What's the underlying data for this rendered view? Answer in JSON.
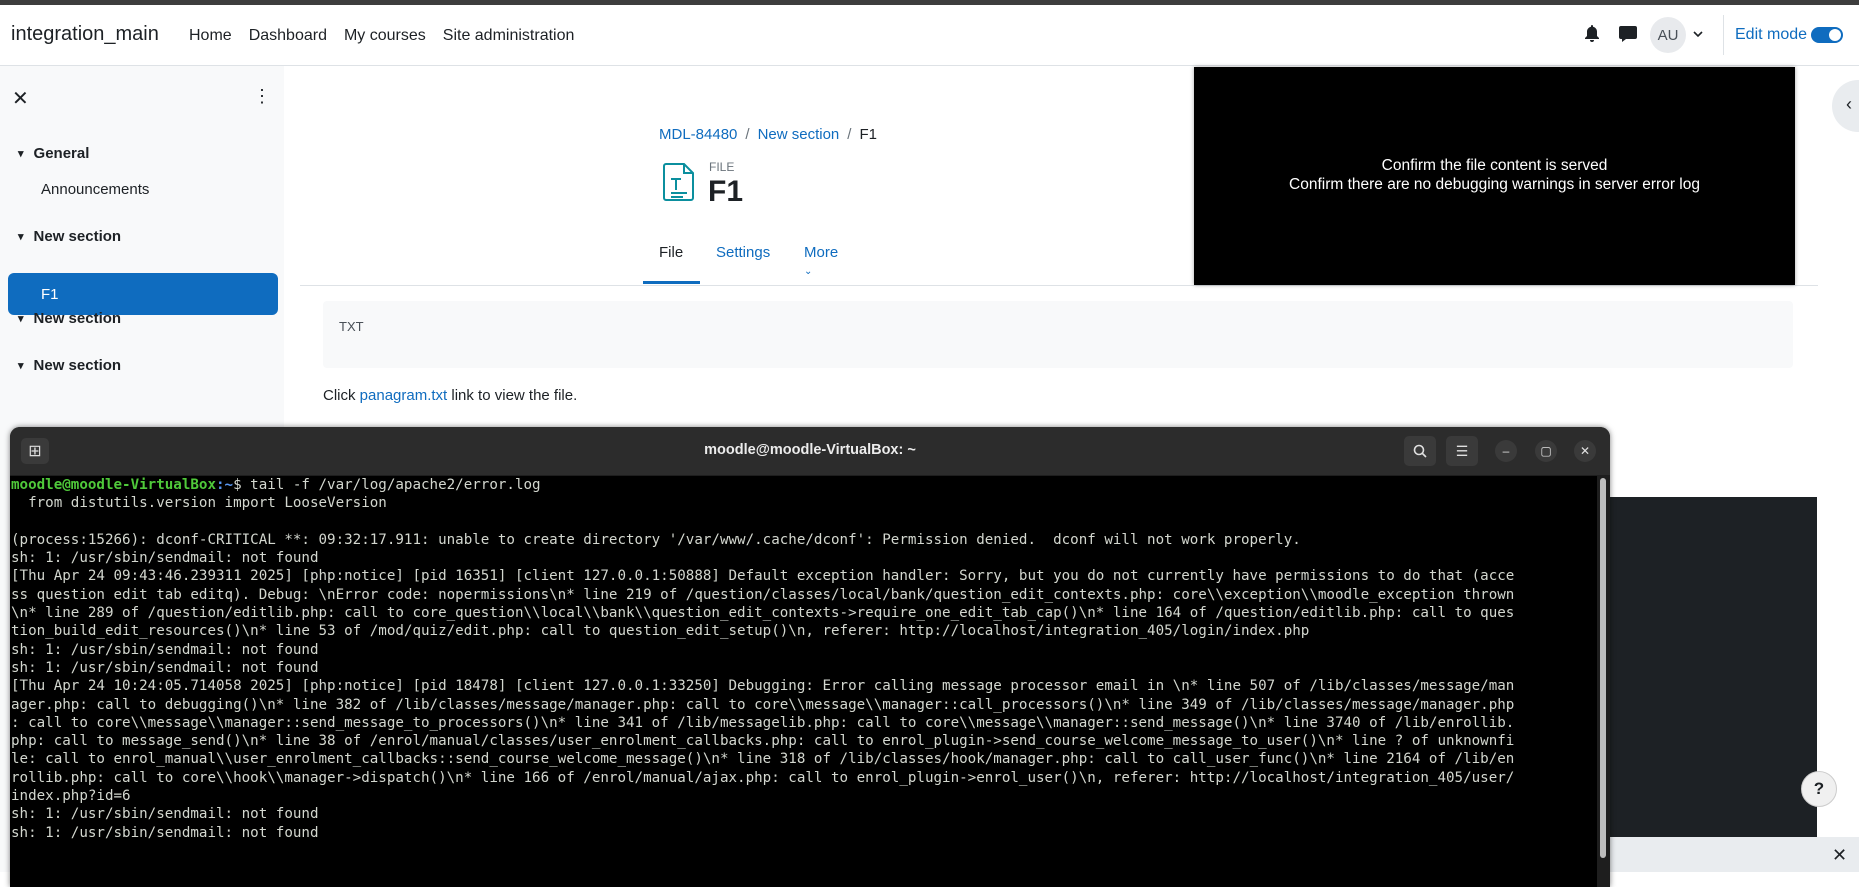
{
  "navbar": {
    "site_name": "integration_main",
    "links": [
      "Home",
      "Dashboard",
      "My courses",
      "Site administration"
    ],
    "avatar_initials": "AU",
    "edit_mode_label": "Edit mode",
    "edit_mode_on": true
  },
  "drawer": {
    "close_icon": "✕",
    "sections": [
      {
        "title": "General",
        "activities": [
          "Announcements"
        ]
      },
      {
        "title": "New section",
        "activities": [
          "F1"
        ]
      },
      {
        "title": "New section",
        "activities": []
      },
      {
        "title": "New section",
        "activities": []
      }
    ],
    "active_activity": "F1"
  },
  "breadcrumb": {
    "items": [
      "MDL-84480",
      "New section",
      "F1"
    ]
  },
  "activity": {
    "type_label": "FILE",
    "title": "F1",
    "tabs": [
      "File",
      "Settings",
      "More"
    ],
    "active_tab": "File",
    "file_type": "TXT",
    "click_prefix": "Click ",
    "link_text": "panagram.txt",
    "click_suffix": " link to view the file."
  },
  "overlay": {
    "line1": "Confirm the file content is served",
    "line2": "Confirm there are no debugging warnings in server error log"
  },
  "terminal": {
    "title": "moodle@moodle-VirtualBox: ~",
    "prompt_user": "moodle@moodle-VirtualBox",
    "prompt_path": ":~",
    "command": "$ tail -f /var/log/apache2/error.log",
    "lines": [
      "  from distutils.version import LooseVersion",
      "",
      "(process:15266): dconf-CRITICAL **: 09:32:17.911: unable to create directory '/var/www/.cache/dconf': Permission denied.  dconf will not work properly.",
      "sh: 1: /usr/sbin/sendmail: not found",
      "[Thu Apr 24 09:43:46.239311 2025] [php:notice] [pid 16351] [client 127.0.0.1:50888] Default exception handler: Sorry, but you do not currently have permissions to do that (acce",
      "ss question edit tab editq). Debug: \\nError code: nopermissions\\n* line 219 of /question/classes/local/bank/question_edit_contexts.php: core\\\\exception\\\\moodle_exception thrown",
      "\\n* line 289 of /question/editlib.php: call to core_question\\\\local\\\\bank\\\\question_edit_contexts->require_one_edit_tab_cap()\\n* line 164 of /question/editlib.php: call to ques",
      "tion_build_edit_resources()\\n* line 53 of /mod/quiz/edit.php: call to question_edit_setup()\\n, referer: http://localhost/integration_405/login/index.php",
      "sh: 1: /usr/sbin/sendmail: not found",
      "sh: 1: /usr/sbin/sendmail: not found",
      "[Thu Apr 24 10:24:05.714058 2025] [php:notice] [pid 18478] [client 127.0.0.1:33250] Debugging: Error calling message processor email in \\n* line 507 of /lib/classes/message/man",
      "ager.php: call to debugging()\\n* line 382 of /lib/classes/message/manager.php: call to core\\\\message\\\\manager::call_processors()\\n* line 349 of /lib/classes/message/manager.php",
      ": call to core\\\\message\\\\manager::send_message_to_processors()\\n* line 341 of /lib/messagelib.php: call to core\\\\message\\\\manager::send_message()\\n* line 3740 of /lib/enrollib.",
      "php: call to message_send()\\n* line 38 of /enrol/manual/classes/user_enrolment_callbacks.php: call to enrol_plugin->send_course_welcome_message_to_user()\\n* line ? of unknownfi",
      "le: call to enrol_manual\\\\user_enrolment_callbacks::send_course_welcome_message()\\n* line 318 of /lib/classes/hook/manager.php: call to call_user_func()\\n* line 2164 of /lib/en",
      "rollib.php: call to core\\\\hook\\\\manager->dispatch()\\n* line 166 of /enrol/manual/ajax.php: call to enrol_plugin->enrol_user()\\n, referer: http://localhost/integration_405/user/",
      "index.php?id=6",
      "sh: 1: /usr/sbin/sendmail: not found",
      "sh: 1: /usr/sbin/sendmail: not found"
    ]
  },
  "help_button": "?",
  "colors": {
    "accent": "#0f6cbf",
    "terminal_bg": "#000000",
    "prompt_green": "#4fc93a",
    "prompt_blue": "#5896f0"
  }
}
